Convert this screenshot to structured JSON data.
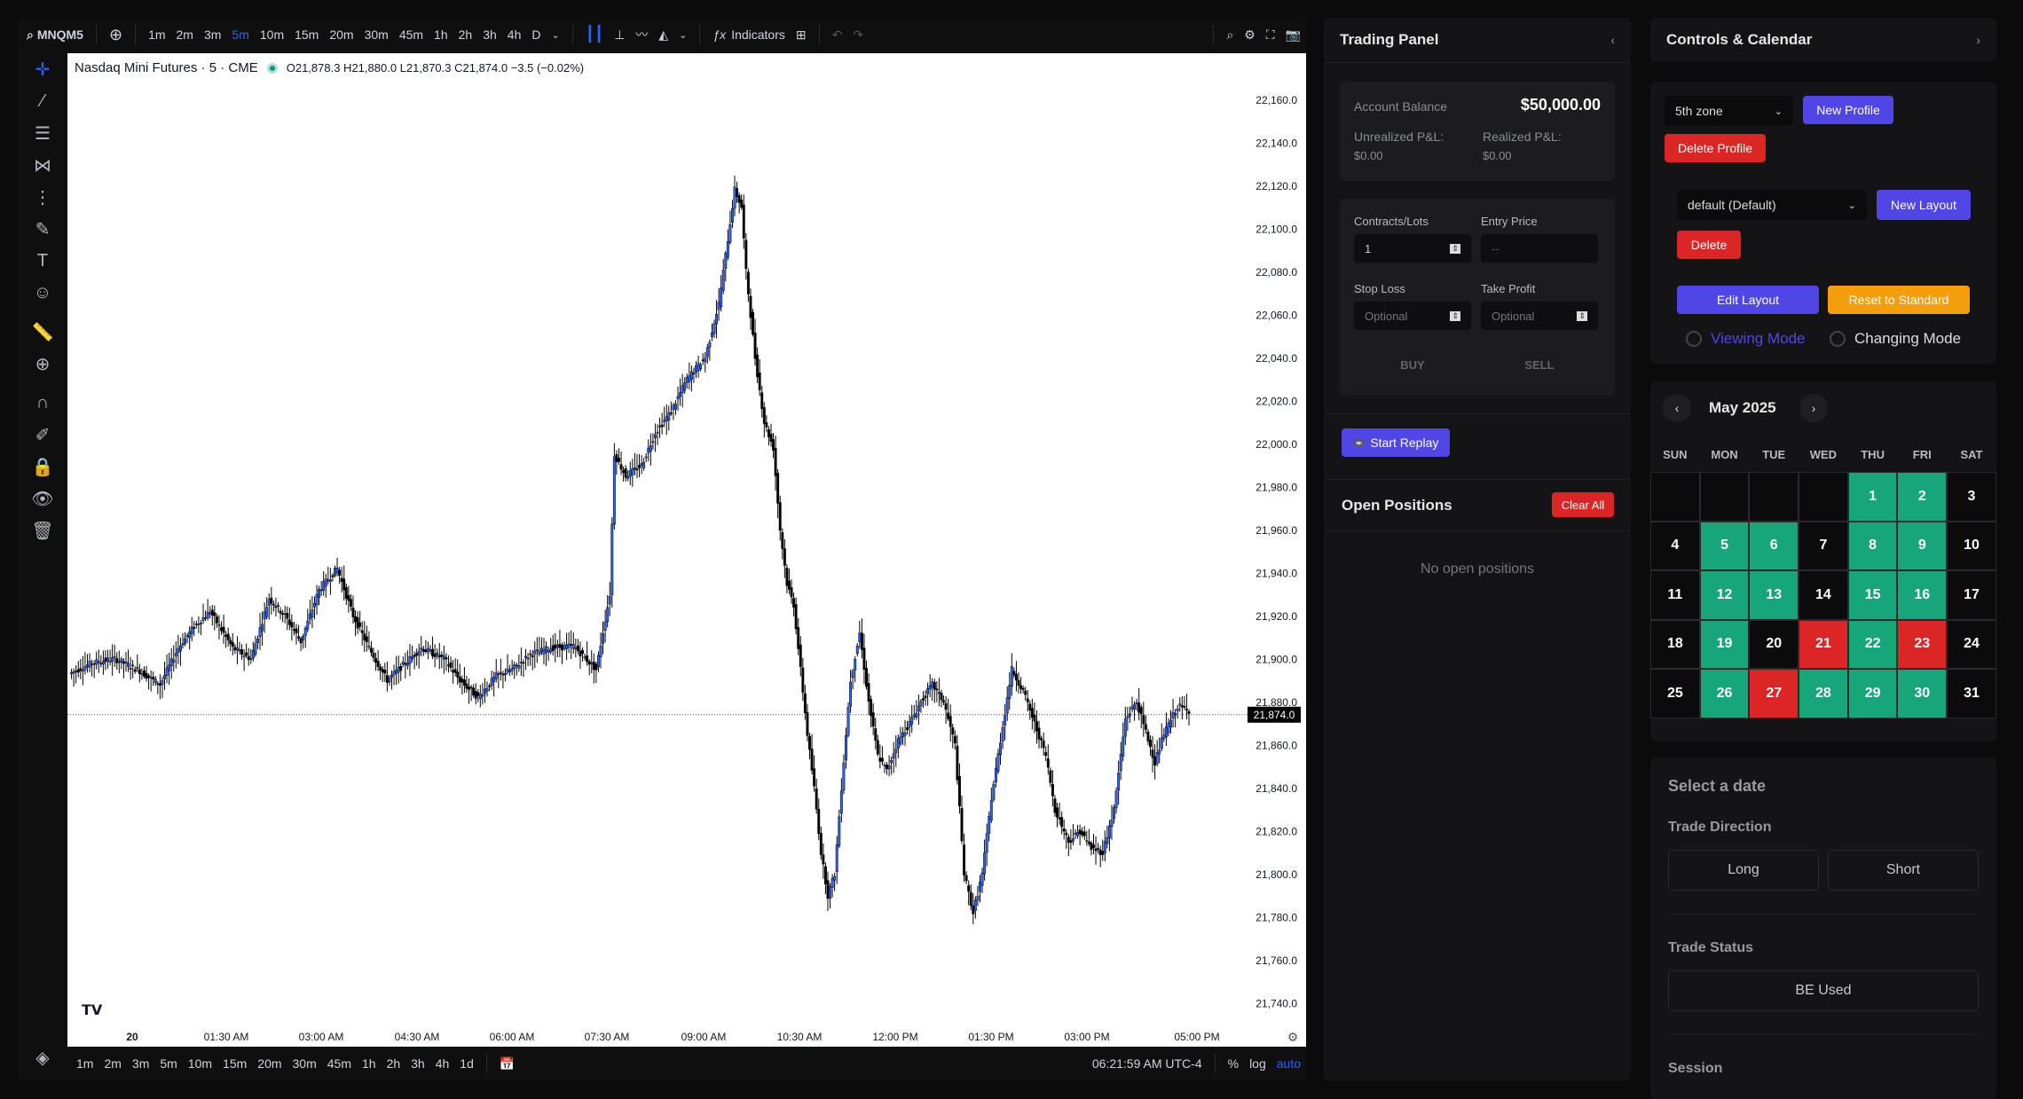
{
  "topbar": {
    "symbol": "MNQM5",
    "intervals": [
      "1m",
      "2m",
      "3m",
      "5m",
      "10m",
      "15m",
      "20m",
      "30m",
      "45m",
      "1h",
      "2h",
      "3h",
      "4h",
      "D"
    ],
    "active_interval": "5m",
    "indicators_label": "Indicators"
  },
  "legend": {
    "title": "Nasdaq Mini Futures · 5 · CME",
    "ohlc": "O21,878.3  H21,880.0  L21,870.3  C21,874.0  −3.5 (−0.02%)"
  },
  "chart_data": {
    "type": "candlestick",
    "y_ticks": [
      "22,160.0",
      "22,140.0",
      "22,120.0",
      "22,100.0",
      "22,080.0",
      "22,060.0",
      "22,040.0",
      "22,020.0",
      "22,000.0",
      "21,980.0",
      "21,960.0",
      "21,940.0",
      "21,920.0",
      "21,900.0",
      "21,880.0",
      "21,860.0",
      "21,840.0",
      "21,820.0",
      "21,800.0",
      "21,780.0",
      "21,760.0",
      "21,740.0"
    ],
    "ylim": [
      21730,
      22165
    ],
    "x_ticks": [
      "20",
      "01:30 AM",
      "03:00 AM",
      "04:30 AM",
      "06:00 AM",
      "07:30 AM",
      "09:00 AM",
      "10:30 AM",
      "12:00 PM",
      "01:30 PM",
      "03:00 PM",
      "05:00 PM"
    ],
    "last_price": 21874.0,
    "last_price_label": "21,874.0",
    "path_points": [
      [
        0,
        21893
      ],
      [
        10,
        21898
      ],
      [
        20,
        21900
      ],
      [
        30,
        21895
      ],
      [
        40,
        21888
      ],
      [
        48,
        21905
      ],
      [
        55,
        21915
      ],
      [
        62,
        21922
      ],
      [
        72,
        21905
      ],
      [
        80,
        21900
      ],
      [
        88,
        21928
      ],
      [
        95,
        21920
      ],
      [
        102,
        21908
      ],
      [
        110,
        21932
      ],
      [
        118,
        21942
      ],
      [
        125,
        21920
      ],
      [
        132,
        21905
      ],
      [
        140,
        21890
      ],
      [
        145,
        21895
      ],
      [
        155,
        21905
      ],
      [
        165,
        21900
      ],
      [
        172,
        21890
      ],
      [
        180,
        21882
      ],
      [
        188,
        21892
      ],
      [
        195,
        21895
      ],
      [
        203,
        21902
      ],
      [
        212,
        21905
      ],
      [
        222,
        21906
      ],
      [
        232,
        21895
      ],
      [
        238,
        21930
      ],
      [
        240,
        21995
      ],
      [
        245,
        21985
      ],
      [
        252,
        21990
      ],
      [
        258,
        22005
      ],
      [
        265,
        22015
      ],
      [
        272,
        22030
      ],
      [
        280,
        22040
      ],
      [
        286,
        22065
      ],
      [
        290,
        22095
      ],
      [
        293,
        22118
      ],
      [
        296,
        22110
      ],
      [
        298,
        22080
      ],
      [
        302,
        22040
      ],
      [
        306,
        22010
      ],
      [
        310,
        21998
      ],
      [
        313,
        21960
      ],
      [
        316,
        21935
      ],
      [
        319,
        21925
      ],
      [
        322,
        21895
      ],
      [
        325,
        21865
      ],
      [
        328,
        21840
      ],
      [
        331,
        21810
      ],
      [
        334,
        21790
      ],
      [
        337,
        21800
      ],
      [
        340,
        21840
      ],
      [
        344,
        21890
      ],
      [
        348,
        21912
      ],
      [
        352,
        21880
      ],
      [
        356,
        21855
      ],
      [
        360,
        21848
      ],
      [
        365,
        21862
      ],
      [
        370,
        21870
      ],
      [
        375,
        21880
      ],
      [
        380,
        21888
      ],
      [
        385,
        21880
      ],
      [
        390,
        21860
      ],
      [
        394,
        21800
      ],
      [
        398,
        21782
      ],
      [
        402,
        21800
      ],
      [
        406,
        21835
      ],
      [
        410,
        21862
      ],
      [
        415,
        21895
      ],
      [
        420,
        21885
      ],
      [
        425,
        21870
      ],
      [
        430,
        21855
      ],
      [
        434,
        21830
      ],
      [
        440,
        21815
      ],
      [
        445,
        21820
      ],
      [
        450,
        21812
      ],
      [
        455,
        21810
      ],
      [
        460,
        21830
      ],
      [
        465,
        21872
      ],
      [
        470,
        21880
      ],
      [
        478,
        21852
      ],
      [
        482,
        21865
      ],
      [
        488,
        21878
      ],
      [
        493,
        21876
      ]
    ]
  },
  "bottombar": {
    "ranges": [
      "1m",
      "2m",
      "3m",
      "5m",
      "10m",
      "15m",
      "20m",
      "30m",
      "45m",
      "1h",
      "2h",
      "3h",
      "4h",
      "1d"
    ],
    "time": "06:21:59 AM UTC-4",
    "pct": "%",
    "log": "log",
    "auto": "auto"
  },
  "trading": {
    "title": "Trading Panel",
    "account_balance_label": "Account Balance",
    "account_balance": "$50,000.00",
    "unrealized_label": "Unrealized P&L:",
    "unrealized_value": "$0.00",
    "realized_label": "Realized P&L:",
    "realized_value": "$0.00",
    "contracts_label": "Contracts/Lots",
    "contracts_value": "1",
    "entry_label": "Entry Price",
    "entry_placeholder": "--",
    "sl_label": "Stop Loss",
    "sl_placeholder": "Optional",
    "tp_label": "Take Profit",
    "tp_placeholder": "Optional",
    "buy": "BUY",
    "sell": "SELL",
    "replay": "Start Replay",
    "open_positions": "Open Positions",
    "clear_all": "Clear All",
    "no_positions": "No open positions"
  },
  "controls": {
    "title": "Controls & Calendar",
    "profile_select": "5th zone",
    "new_profile": "New Profile",
    "delete_profile": "Delete Profile",
    "layout_select": "default (Default)",
    "new_layout": "New Layout",
    "delete": "Delete",
    "edit_layout": "Edit Layout",
    "reset": "Reset to Standard",
    "viewing_mode": "Viewing Mode",
    "changing_mode": "Changing Mode",
    "colors": {
      "purple": "#4f46e5",
      "red": "#dc2626",
      "orange": "#f59e0b",
      "green": "#16a67a"
    }
  },
  "calendar": {
    "month": "May 2025",
    "dow": [
      "SUN",
      "MON",
      "TUE",
      "WED",
      "THU",
      "FRI",
      "SAT"
    ],
    "weeks": [
      [
        [
          "",
          ""
        ],
        [
          "",
          ""
        ],
        [
          "",
          ""
        ],
        [
          "",
          ""
        ],
        [
          "1",
          "g"
        ],
        [
          "2",
          "g"
        ],
        [
          "3",
          ""
        ]
      ],
      [
        [
          "4",
          ""
        ],
        [
          "5",
          "g"
        ],
        [
          "6",
          "g"
        ],
        [
          "7",
          ""
        ],
        [
          "8",
          "g"
        ],
        [
          "9",
          "g"
        ],
        [
          "10",
          ""
        ]
      ],
      [
        [
          "11",
          ""
        ],
        [
          "12",
          "g"
        ],
        [
          "13",
          "g"
        ],
        [
          "14",
          ""
        ],
        [
          "15",
          "g"
        ],
        [
          "16",
          "g"
        ],
        [
          "17",
          ""
        ]
      ],
      [
        [
          "18",
          ""
        ],
        [
          "19",
          "g"
        ],
        [
          "20",
          ""
        ],
        [
          "21",
          "r"
        ],
        [
          "22",
          "g"
        ],
        [
          "23",
          "r"
        ],
        [
          "24",
          ""
        ]
      ],
      [
        [
          "25",
          ""
        ],
        [
          "26",
          "g"
        ],
        [
          "27",
          "r"
        ],
        [
          "28",
          "g"
        ],
        [
          "29",
          "g"
        ],
        [
          "30",
          "g"
        ],
        [
          "31",
          ""
        ]
      ]
    ]
  },
  "details": {
    "select_date": "Select a date",
    "trade_direction": "Trade Direction",
    "long": "Long",
    "short": "Short",
    "trade_status": "Trade Status",
    "be_used": "BE Used",
    "session": "Session"
  }
}
